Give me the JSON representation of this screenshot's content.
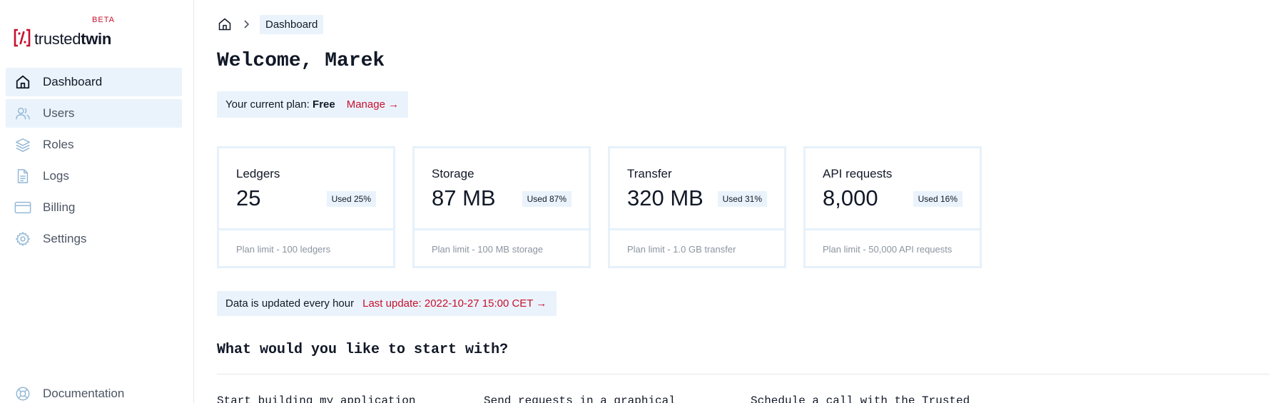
{
  "brand": {
    "name_light": "trusted",
    "name_bold": "twin",
    "badge": "BETA",
    "accent_color": "#c8102e",
    "logo_icon": "trustedtwin-logo-icon"
  },
  "sidebar": {
    "items": [
      {
        "label": "Dashboard",
        "icon": "home-icon",
        "state": "active"
      },
      {
        "label": "Users",
        "icon": "users-icon",
        "state": "hover"
      },
      {
        "label": "Roles",
        "icon": "layers-icon",
        "state": "default"
      },
      {
        "label": "Logs",
        "icon": "document-icon",
        "state": "default"
      },
      {
        "label": "Billing",
        "icon": "credit-card-icon",
        "state": "default"
      },
      {
        "label": "Settings",
        "icon": "gear-icon",
        "state": "default"
      }
    ],
    "bottom_items": [
      {
        "label": "Documentation",
        "icon": "lifebuoy-icon"
      }
    ]
  },
  "breadcrumb": {
    "home_icon": "home-icon",
    "separator_icon": "chevron-right-icon",
    "current": "Dashboard"
  },
  "page": {
    "welcome": "Welcome, Marek"
  },
  "plan": {
    "label": "Your current plan: ",
    "name": "Free",
    "manage_label": "Manage →"
  },
  "cards": [
    {
      "title": "Ledgers",
      "value": "25",
      "badge": "Used 25%",
      "limit": "Plan limit - 100 ledgers"
    },
    {
      "title": "Storage",
      "value": "87 MB",
      "badge": "Used 87%",
      "limit": "Plan limit - 100 MB storage"
    },
    {
      "title": "Transfer",
      "value": "320 MB",
      "badge": "Used 31%",
      "limit": "Plan limit - 1.0 GB transfer"
    },
    {
      "title": "API requests",
      "value": "8,000",
      "badge": "Used 16%",
      "limit": "Plan limit - 50,000 API requests"
    }
  ],
  "update": {
    "text": "Data is updated every hour",
    "link": "Last update: 2022-10-27 15:00 CET →"
  },
  "start": {
    "title": "What would you like to start with?",
    "options": [
      "Start building my application",
      "Send requests in a graphical",
      "Schedule a call with the Trusted"
    ]
  }
}
